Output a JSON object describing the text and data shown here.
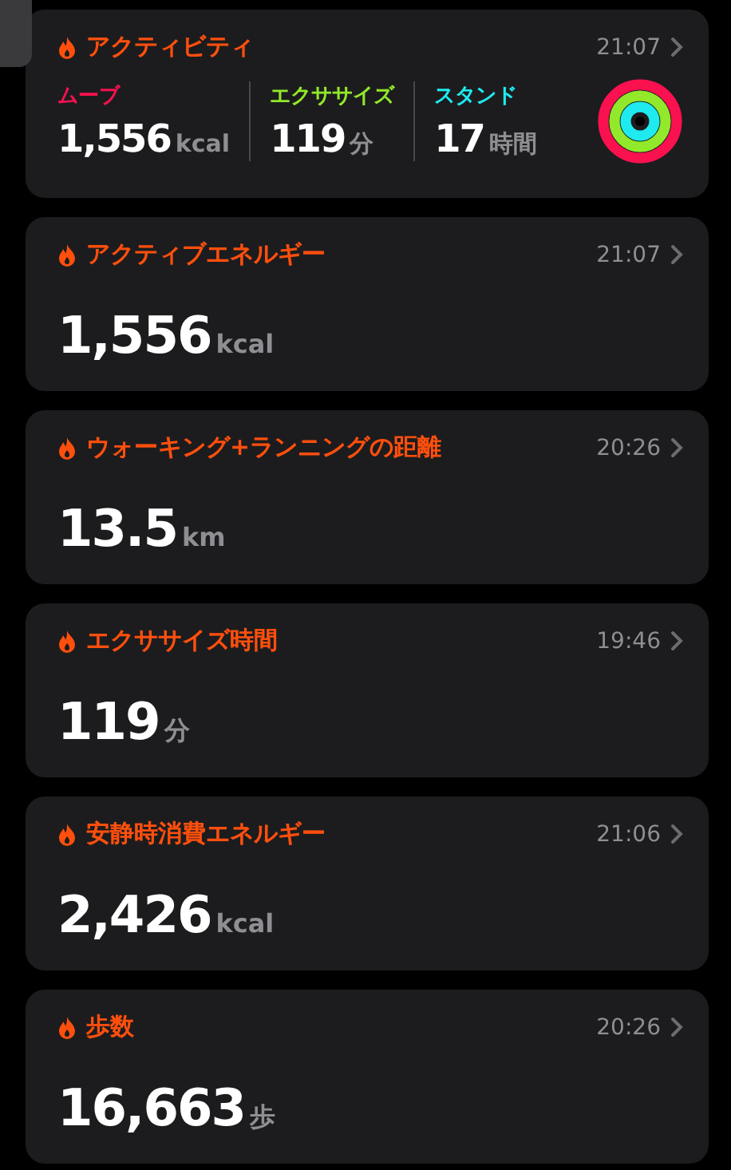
{
  "activity": {
    "title": "アクティビティ",
    "time": "21:07",
    "metrics": [
      {
        "label": "ムーブ",
        "value": "1,556",
        "unit": "kcal",
        "color": "#fa114f"
      },
      {
        "label": "エクササイズ",
        "value": "119",
        "unit": "分",
        "color": "#92e82a"
      },
      {
        "label": "スタンド",
        "value": "17",
        "unit": "時間",
        "color": "#1eeaef"
      }
    ],
    "rings": [
      {
        "color": "#fa114f",
        "level": 1
      },
      {
        "color": "#92e82a",
        "level": 1
      },
      {
        "color": "#1eeaef",
        "level": 1
      }
    ]
  },
  "cards": [
    {
      "title": "アクティブエネルギー",
      "time": "21:07",
      "value": "1,556",
      "unit": "kcal"
    },
    {
      "title": "ウォーキング+ランニングの距離",
      "time": "20:26",
      "value": "13.5",
      "unit": "km"
    },
    {
      "title": "エクササイズ時間",
      "time": "19:46",
      "value": "119",
      "unit": "分"
    },
    {
      "title": "安静時消費エネルギー",
      "time": "21:06",
      "value": "2,426",
      "unit": "kcal"
    },
    {
      "title": "歩数",
      "time": "20:26",
      "value": "16,663",
      "unit": "歩"
    }
  ]
}
